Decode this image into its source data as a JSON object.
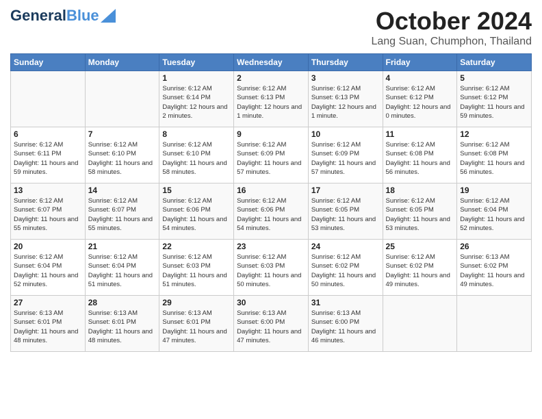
{
  "header": {
    "logo_general": "General",
    "logo_blue": "Blue",
    "month": "October 2024",
    "location": "Lang Suan, Chumphon, Thailand"
  },
  "days_of_week": [
    "Sunday",
    "Monday",
    "Tuesday",
    "Wednesday",
    "Thursday",
    "Friday",
    "Saturday"
  ],
  "weeks": [
    [
      {
        "day": "",
        "sunrise": "",
        "sunset": "",
        "daylight": ""
      },
      {
        "day": "",
        "sunrise": "",
        "sunset": "",
        "daylight": ""
      },
      {
        "day": "1",
        "sunrise": "Sunrise: 6:12 AM",
        "sunset": "Sunset: 6:14 PM",
        "daylight": "Daylight: 12 hours and 2 minutes."
      },
      {
        "day": "2",
        "sunrise": "Sunrise: 6:12 AM",
        "sunset": "Sunset: 6:13 PM",
        "daylight": "Daylight: 12 hours and 1 minute."
      },
      {
        "day": "3",
        "sunrise": "Sunrise: 6:12 AM",
        "sunset": "Sunset: 6:13 PM",
        "daylight": "Daylight: 12 hours and 1 minute."
      },
      {
        "day": "4",
        "sunrise": "Sunrise: 6:12 AM",
        "sunset": "Sunset: 6:12 PM",
        "daylight": "Daylight: 12 hours and 0 minutes."
      },
      {
        "day": "5",
        "sunrise": "Sunrise: 6:12 AM",
        "sunset": "Sunset: 6:12 PM",
        "daylight": "Daylight: 11 hours and 59 minutes."
      }
    ],
    [
      {
        "day": "6",
        "sunrise": "Sunrise: 6:12 AM",
        "sunset": "Sunset: 6:11 PM",
        "daylight": "Daylight: 11 hours and 59 minutes."
      },
      {
        "day": "7",
        "sunrise": "Sunrise: 6:12 AM",
        "sunset": "Sunset: 6:10 PM",
        "daylight": "Daylight: 11 hours and 58 minutes."
      },
      {
        "day": "8",
        "sunrise": "Sunrise: 6:12 AM",
        "sunset": "Sunset: 6:10 PM",
        "daylight": "Daylight: 11 hours and 58 minutes."
      },
      {
        "day": "9",
        "sunrise": "Sunrise: 6:12 AM",
        "sunset": "Sunset: 6:09 PM",
        "daylight": "Daylight: 11 hours and 57 minutes."
      },
      {
        "day": "10",
        "sunrise": "Sunrise: 6:12 AM",
        "sunset": "Sunset: 6:09 PM",
        "daylight": "Daylight: 11 hours and 57 minutes."
      },
      {
        "day": "11",
        "sunrise": "Sunrise: 6:12 AM",
        "sunset": "Sunset: 6:08 PM",
        "daylight": "Daylight: 11 hours and 56 minutes."
      },
      {
        "day": "12",
        "sunrise": "Sunrise: 6:12 AM",
        "sunset": "Sunset: 6:08 PM",
        "daylight": "Daylight: 11 hours and 56 minutes."
      }
    ],
    [
      {
        "day": "13",
        "sunrise": "Sunrise: 6:12 AM",
        "sunset": "Sunset: 6:07 PM",
        "daylight": "Daylight: 11 hours and 55 minutes."
      },
      {
        "day": "14",
        "sunrise": "Sunrise: 6:12 AM",
        "sunset": "Sunset: 6:07 PM",
        "daylight": "Daylight: 11 hours and 55 minutes."
      },
      {
        "day": "15",
        "sunrise": "Sunrise: 6:12 AM",
        "sunset": "Sunset: 6:06 PM",
        "daylight": "Daylight: 11 hours and 54 minutes."
      },
      {
        "day": "16",
        "sunrise": "Sunrise: 6:12 AM",
        "sunset": "Sunset: 6:06 PM",
        "daylight": "Daylight: 11 hours and 54 minutes."
      },
      {
        "day": "17",
        "sunrise": "Sunrise: 6:12 AM",
        "sunset": "Sunset: 6:05 PM",
        "daylight": "Daylight: 11 hours and 53 minutes."
      },
      {
        "day": "18",
        "sunrise": "Sunrise: 6:12 AM",
        "sunset": "Sunset: 6:05 PM",
        "daylight": "Daylight: 11 hours and 53 minutes."
      },
      {
        "day": "19",
        "sunrise": "Sunrise: 6:12 AM",
        "sunset": "Sunset: 6:04 PM",
        "daylight": "Daylight: 11 hours and 52 minutes."
      }
    ],
    [
      {
        "day": "20",
        "sunrise": "Sunrise: 6:12 AM",
        "sunset": "Sunset: 6:04 PM",
        "daylight": "Daylight: 11 hours and 52 minutes."
      },
      {
        "day": "21",
        "sunrise": "Sunrise: 6:12 AM",
        "sunset": "Sunset: 6:04 PM",
        "daylight": "Daylight: 11 hours and 51 minutes."
      },
      {
        "day": "22",
        "sunrise": "Sunrise: 6:12 AM",
        "sunset": "Sunset: 6:03 PM",
        "daylight": "Daylight: 11 hours and 51 minutes."
      },
      {
        "day": "23",
        "sunrise": "Sunrise: 6:12 AM",
        "sunset": "Sunset: 6:03 PM",
        "daylight": "Daylight: 11 hours and 50 minutes."
      },
      {
        "day": "24",
        "sunrise": "Sunrise: 6:12 AM",
        "sunset": "Sunset: 6:02 PM",
        "daylight": "Daylight: 11 hours and 50 minutes."
      },
      {
        "day": "25",
        "sunrise": "Sunrise: 6:12 AM",
        "sunset": "Sunset: 6:02 PM",
        "daylight": "Daylight: 11 hours and 49 minutes."
      },
      {
        "day": "26",
        "sunrise": "Sunrise: 6:13 AM",
        "sunset": "Sunset: 6:02 PM",
        "daylight": "Daylight: 11 hours and 49 minutes."
      }
    ],
    [
      {
        "day": "27",
        "sunrise": "Sunrise: 6:13 AM",
        "sunset": "Sunset: 6:01 PM",
        "daylight": "Daylight: 11 hours and 48 minutes."
      },
      {
        "day": "28",
        "sunrise": "Sunrise: 6:13 AM",
        "sunset": "Sunset: 6:01 PM",
        "daylight": "Daylight: 11 hours and 48 minutes."
      },
      {
        "day": "29",
        "sunrise": "Sunrise: 6:13 AM",
        "sunset": "Sunset: 6:01 PM",
        "daylight": "Daylight: 11 hours and 47 minutes."
      },
      {
        "day": "30",
        "sunrise": "Sunrise: 6:13 AM",
        "sunset": "Sunset: 6:00 PM",
        "daylight": "Daylight: 11 hours and 47 minutes."
      },
      {
        "day": "31",
        "sunrise": "Sunrise: 6:13 AM",
        "sunset": "Sunset: 6:00 PM",
        "daylight": "Daylight: 11 hours and 46 minutes."
      },
      {
        "day": "",
        "sunrise": "",
        "sunset": "",
        "daylight": ""
      },
      {
        "day": "",
        "sunrise": "",
        "sunset": "",
        "daylight": ""
      }
    ]
  ]
}
